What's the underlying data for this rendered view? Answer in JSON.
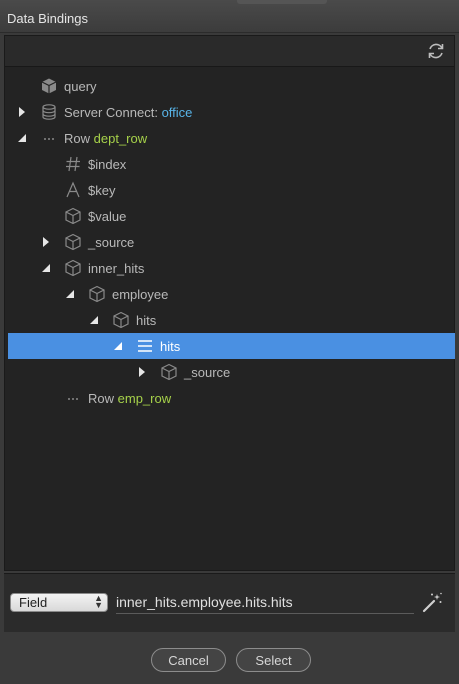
{
  "window": {
    "title": "Data Bindings"
  },
  "tree": [
    {
      "label": "query"
    },
    {
      "label": "Server Connect:",
      "accent": "office"
    },
    {
      "label": "Row",
      "accent": "dept_row"
    },
    {
      "label": "$index"
    },
    {
      "label": "$key"
    },
    {
      "label": "$value"
    },
    {
      "label": "_source"
    },
    {
      "label": "inner_hits"
    },
    {
      "label": "employee"
    },
    {
      "label": "hits"
    },
    {
      "label": "hits",
      "selected": true
    },
    {
      "label": "_source"
    },
    {
      "label": "Row",
      "accent": "emp_row"
    }
  ],
  "bottom": {
    "type_select": "Field",
    "expression": "inner_hits.employee.hits.hits"
  },
  "buttons": {
    "cancel": "Cancel",
    "select": "Select"
  },
  "colors": {
    "selection": "#4a90e2",
    "accent_blue": "#58b4e8",
    "accent_green": "#a6d14a"
  },
  "icons": [
    "refresh-icon",
    "cube-icon",
    "database-icon",
    "ellipsis-icon",
    "hash-icon",
    "text-a-icon",
    "list-icon",
    "magic-wand-icon"
  ]
}
